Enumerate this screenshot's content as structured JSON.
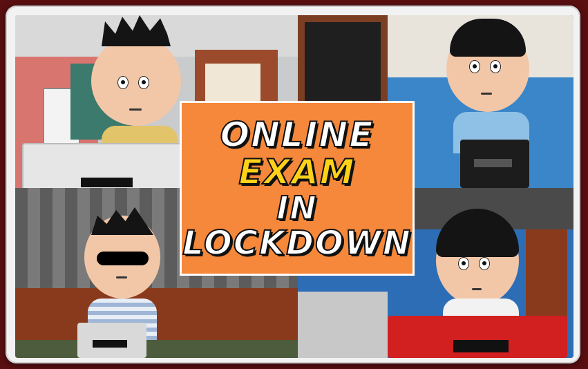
{
  "title_card": {
    "line1": "ONLINE",
    "line2": "EXAM",
    "line3": "IN",
    "line4": "LOCKDOWN"
  },
  "colors": {
    "card_background": "#f5883a",
    "exam_text": "#ffd21a",
    "outer_background": "#5a0f10"
  }
}
